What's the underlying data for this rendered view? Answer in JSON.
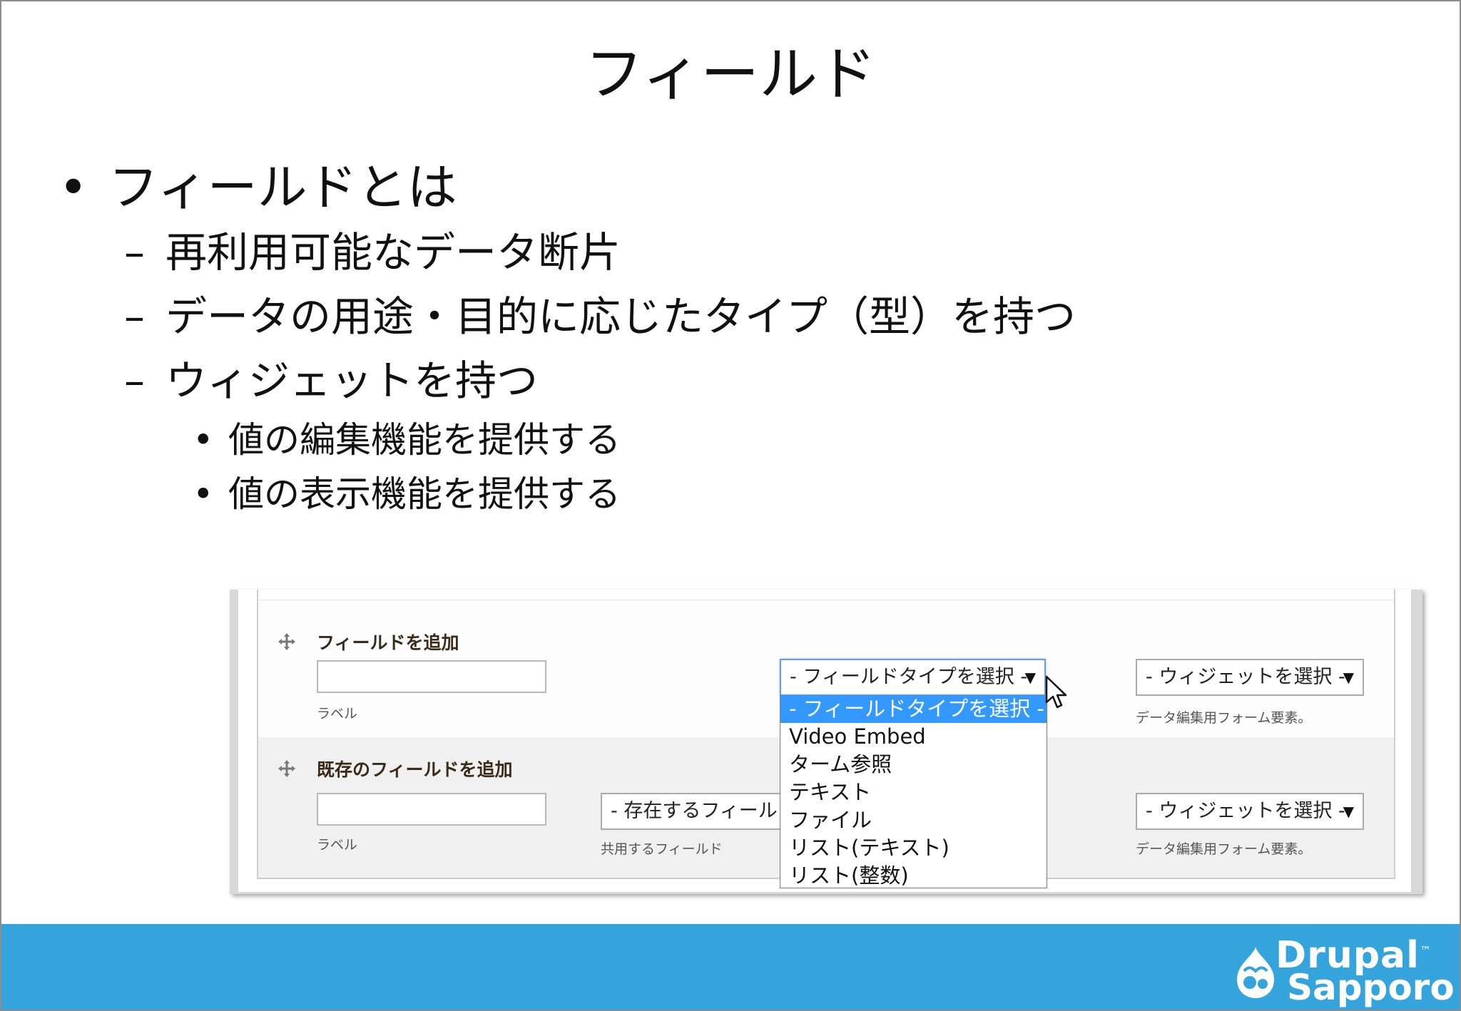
{
  "slide": {
    "title": "フィールド",
    "bullets": {
      "level1": {
        "marker": "•",
        "text": "フィールドとは"
      },
      "level2": [
        {
          "marker": "–",
          "text": "再利用可能なデータ断片"
        },
        {
          "marker": "–",
          "text": "データの用途・目的に応じたタイプ（型）を持つ"
        },
        {
          "marker": "–",
          "text": "ウィジェットを持つ"
        }
      ],
      "level3": [
        {
          "marker": "•",
          "text": "値の編集機能を提供する"
        },
        {
          "marker": "•",
          "text": "値の表示機能を提供する"
        }
      ]
    }
  },
  "screenshot": {
    "add_field": {
      "title": "フィールドを追加",
      "label_caption": "ラベル",
      "field_type_select": "- フィールドタイプを選択 -",
      "widget_select": "- ウィジェットを選択 -",
      "widget_caption": "データ編集用フォーム要素。"
    },
    "existing_field": {
      "title": "既存のフィールドを追加",
      "label_caption": "ラベル",
      "existing_select": "- 存在するフィールド",
      "existing_caption": "共用するフィールド",
      "widget_select": "- ウィジェットを選択 -",
      "widget_caption": "データ編集用フォーム要素。"
    },
    "dropdown_options": [
      "- フィールドタイプを選択 -",
      "Video Embed",
      "ターム参照",
      "テキスト",
      "ファイル",
      "リスト(テキスト)",
      "リスト(整数)"
    ],
    "selected_option_index": 0
  },
  "footer": {
    "accent_color": "#35a4dd",
    "logo_line1": "Drupal",
    "logo_tm": "™",
    "logo_line2": "Sapporo"
  },
  "icons": {
    "drag_handle": "move-arrows-icon",
    "cursor": "mouse-pointer-icon",
    "select_arrow": "▼"
  }
}
